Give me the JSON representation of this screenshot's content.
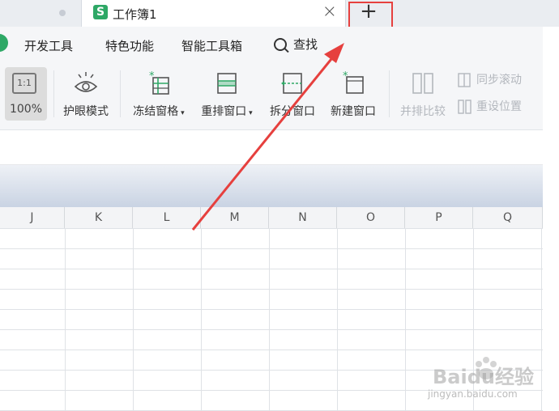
{
  "tabs": {
    "active_title": "工作簿1",
    "doc_icon_letter": "S",
    "close_symbol": "×",
    "new_tab_symbol": "+"
  },
  "menu": {
    "items": [
      "开发工具",
      "特色功能",
      "智能工具箱"
    ],
    "search_label": "查找"
  },
  "ribbon": {
    "zoom_icon_text": "1:1",
    "zoom_label": "100%",
    "eye_mode": "护眼模式",
    "freeze": "冻结窗格",
    "arrange": "重排窗口",
    "split": "拆分窗口",
    "new_window": "新建窗口",
    "side_by_side": "并排比较",
    "sync_scroll": "同步滚动",
    "reset_position": "重设位置"
  },
  "columns": [
    "J",
    "K",
    "L",
    "M",
    "N",
    "O",
    "P",
    "Q"
  ],
  "watermark": {
    "brand": "Baidu经验",
    "url": "jingyan.baidu.com"
  },
  "colors": {
    "accent_green": "#2ea866",
    "annotation_red": "#e6403e"
  }
}
